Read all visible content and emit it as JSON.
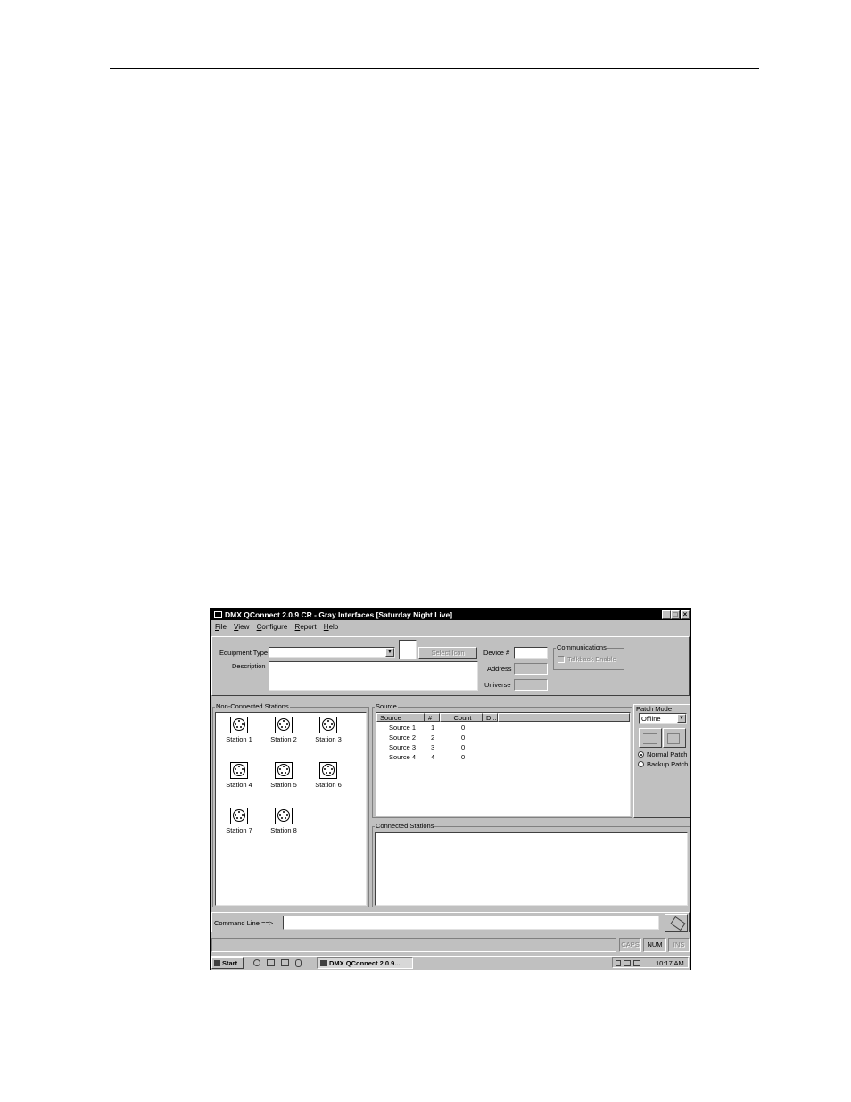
{
  "window": {
    "title": "DMX QConnect 2.0.9 CR - Gray Interfaces [Saturday Night Live]",
    "min_glyph": "_",
    "max_glyph": "□",
    "close_glyph": "×"
  },
  "menu": [
    {
      "label": "File",
      "accel": "F",
      "rest": "ile"
    },
    {
      "label": "View",
      "accel": "V",
      "rest": "iew"
    },
    {
      "label": "Configure",
      "accel": "C",
      "rest": "onfigure"
    },
    {
      "label": "Report",
      "accel": "R",
      "rest": "eport"
    },
    {
      "label": "Help",
      "accel": "H",
      "rest": "elp"
    }
  ],
  "form": {
    "equipment_type_label": "Equipment Type",
    "equipment_type_value": "",
    "description_label": "Description",
    "description_value": "",
    "select_icon_label": "Select Icon",
    "device_label": "Device #",
    "device_value": "",
    "address_label": "Address",
    "universe_label": "Universe",
    "communications_label": "Communications",
    "talkback_label": "Talkback Enable"
  },
  "non_connected": {
    "label": "Non-Connected Stations",
    "stations": [
      "Station 1",
      "Station 2",
      "Station 3",
      "Station 4",
      "Station 5",
      "Station 6",
      "Station 7",
      "Station 8"
    ]
  },
  "source_panel": {
    "label": "Source",
    "columns": [
      "Source",
      "#",
      "Count",
      "D..."
    ],
    "rows": [
      {
        "source": "Source 1",
        "num": "1",
        "count": "0"
      },
      {
        "source": "Source 2",
        "num": "2",
        "count": "0"
      },
      {
        "source": "Source 3",
        "num": "3",
        "count": "0"
      },
      {
        "source": "Source 4",
        "num": "4",
        "count": "0"
      }
    ]
  },
  "patch_mode": {
    "label": "Patch Mode",
    "selected": "Offline",
    "normal_label": "Normal Patch",
    "backup_label": "Backup Patch",
    "normal_checked": true
  },
  "connected": {
    "label": "Connected Stations"
  },
  "command_line": {
    "label": "Command Line ==>",
    "value": ""
  },
  "status_bar": {
    "caps": "CAPS",
    "num": "NUM",
    "ins": "INS"
  },
  "taskbar": {
    "start_label": "Start",
    "task_label": "DMX QConnect 2.0.9...",
    "clock": "10:17 AM"
  }
}
